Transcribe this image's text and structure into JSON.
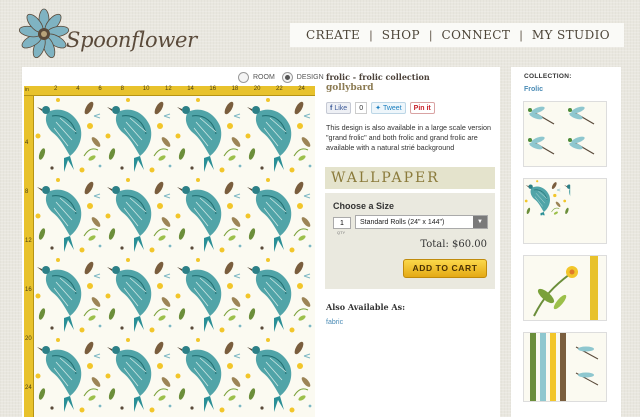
{
  "header": {
    "logo_text": "Spoonflower",
    "nav": [
      "CREATE",
      "SHOP",
      "CONNECT",
      "MY STUDIO"
    ]
  },
  "view_toggle": {
    "room_label": "ROOM",
    "design_label": "DESIGN",
    "selected": "DESIGN"
  },
  "ruler": {
    "unit": "in",
    "top_ticks": [
      "2",
      "4",
      "6",
      "8",
      "10",
      "12",
      "14",
      "16",
      "18",
      "20",
      "22",
      "24"
    ],
    "left_ticks": [
      "4",
      "8",
      "12",
      "16",
      "20",
      "24"
    ]
  },
  "product": {
    "title": "frolic - frolic collection",
    "designer": "gollybard",
    "social": {
      "like": "Like",
      "like_count": "0",
      "tweet": "Tweet",
      "pin": "Pin it"
    },
    "description": "This design is also available in a large scale version \"grand frolic\" and both frolic and grand frolic are available with a natural strié background",
    "category": "WALLPAPER",
    "size_label": "Choose a Size",
    "quantity": "1",
    "qty_label": "QTY",
    "size_selected": "Standard Rolls (24\" x 144\")",
    "total": "Total: $60.00",
    "add_to_cart": "ADD TO CART",
    "also_available_title": "Also Available As:",
    "also_available_link": "fabric"
  },
  "collection": {
    "title": "COLLECTION:",
    "link": "Frolic"
  },
  "colors": {
    "ruler": "#e8c22c",
    "accent_link": "#4a8bb5",
    "cart_button": "#f0c02a",
    "wallpaper_band": "#e4e3cc"
  },
  "icons": [
    "flower-logo-icon",
    "radio-icon",
    "dropdown-arrow-icon",
    "facebook-icon",
    "twitter-icon"
  ]
}
